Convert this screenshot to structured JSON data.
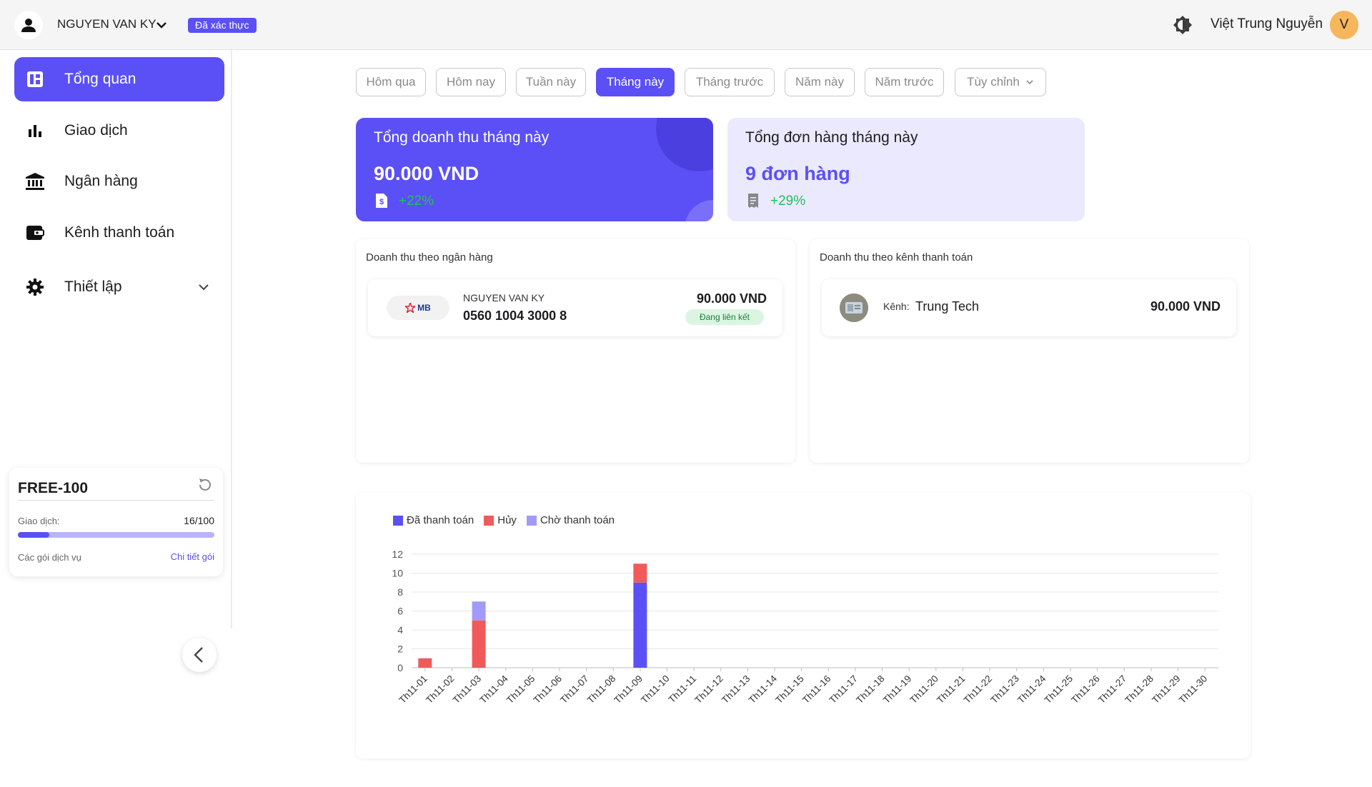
{
  "header": {
    "account_name": "NGUYEN VAN KY",
    "verified_badge": "Đã xác thực",
    "user_name": "Việt Trung Nguyễn",
    "user_initial": "V",
    "icons": [
      "user-icon",
      "chevron-down-icon",
      "theme-toggle-icon"
    ]
  },
  "sidebar": {
    "items": [
      {
        "label": "Tổng quan",
        "icon": "dashboard-icon",
        "active": true
      },
      {
        "label": "Giao dịch",
        "icon": "bar-chart-icon",
        "active": false
      },
      {
        "label": "Ngân hàng",
        "icon": "bank-icon",
        "active": false
      },
      {
        "label": "Kênh thanh toán",
        "icon": "wallet-icon",
        "active": false
      },
      {
        "label": "Thiết lập",
        "icon": "gear-icon",
        "active": false,
        "expandable": true
      }
    ],
    "plan": {
      "name": "FREE-100",
      "usage_label": "Giao dịch:",
      "usage_value": "16/100",
      "usage_fraction": 0.16,
      "services_label": "Các gói dịch vụ",
      "detail_link": "Chi tiết gói"
    }
  },
  "filters": [
    {
      "label": "Hôm qua",
      "active": false
    },
    {
      "label": "Hôm nay",
      "active": false
    },
    {
      "label": "Tuần này",
      "active": false
    },
    {
      "label": "Tháng này",
      "active": true
    },
    {
      "label": "Tháng trước",
      "active": false
    },
    {
      "label": "Năm này",
      "active": false
    },
    {
      "label": "Năm trước",
      "active": false
    },
    {
      "label": "Tùy chỉnh",
      "active": false,
      "dropdown": true
    }
  ],
  "stats": {
    "revenue": {
      "title": "Tổng doanh thu tháng này",
      "value": "90.000 VND",
      "change": "+22%"
    },
    "orders": {
      "title": "Tổng đơn hàng tháng này",
      "value": "9 đơn hàng",
      "change": "+29%"
    }
  },
  "bank_panel": {
    "title": "Doanh thu theo ngân hàng",
    "bank_logo_text": "MB",
    "owner": "NGUYEN VAN KY",
    "account": "0560 1004 3000 8",
    "amount": "90.000 VND",
    "status": "Đang liên kết"
  },
  "channel_panel": {
    "title": "Doanh thu theo kênh thanh toán",
    "label": "Kênh:",
    "name": "Trung Tech",
    "amount": "90.000 VND"
  },
  "colors": {
    "accent": "#5b50f5",
    "paid": "#5b50f5",
    "cancelled": "#ef5b5b",
    "pending": "#a29af8",
    "positive": "#22c05a"
  },
  "chart_data": {
    "type": "bar",
    "stacked": true,
    "legend_position": "top-left",
    "grid": true,
    "ylim": [
      0,
      12
    ],
    "yticks": [
      0,
      2,
      4,
      6,
      8,
      10,
      12
    ],
    "categories": [
      "Th11-01",
      "Th11-02",
      "Th11-03",
      "Th11-04",
      "Th11-05",
      "Th11-06",
      "Th11-07",
      "Th11-08",
      "Th11-09",
      "Th11-10",
      "Th11-11",
      "Th11-12",
      "Th11-13",
      "Th11-14",
      "Th11-15",
      "Th11-16",
      "Th11-17",
      "Th11-18",
      "Th11-19",
      "Th11-20",
      "Th11-21",
      "Th11-22",
      "Th11-23",
      "Th11-24",
      "Th11-25",
      "Th11-26",
      "Th11-27",
      "Th11-28",
      "Th11-29",
      "Th11-30"
    ],
    "series": [
      {
        "name": "Đã thanh toán",
        "color": "#5b50f5",
        "values": [
          0,
          0,
          0,
          0,
          0,
          0,
          0,
          0,
          9,
          0,
          0,
          0,
          0,
          0,
          0,
          0,
          0,
          0,
          0,
          0,
          0,
          0,
          0,
          0,
          0,
          0,
          0,
          0,
          0,
          0
        ]
      },
      {
        "name": "Hủy",
        "color": "#ef5b5b",
        "values": [
          1,
          0,
          5,
          0,
          0,
          0,
          0,
          0,
          2,
          0,
          0,
          0,
          0,
          0,
          0,
          0,
          0,
          0,
          0,
          0,
          0,
          0,
          0,
          0,
          0,
          0,
          0,
          0,
          0,
          0
        ]
      },
      {
        "name": "Chờ thanh toán",
        "color": "#a29af8",
        "values": [
          0,
          0,
          2,
          0,
          0,
          0,
          0,
          0,
          0,
          0,
          0,
          0,
          0,
          0,
          0,
          0,
          0,
          0,
          0,
          0,
          0,
          0,
          0,
          0,
          0,
          0,
          0,
          0,
          0,
          0
        ]
      }
    ]
  }
}
